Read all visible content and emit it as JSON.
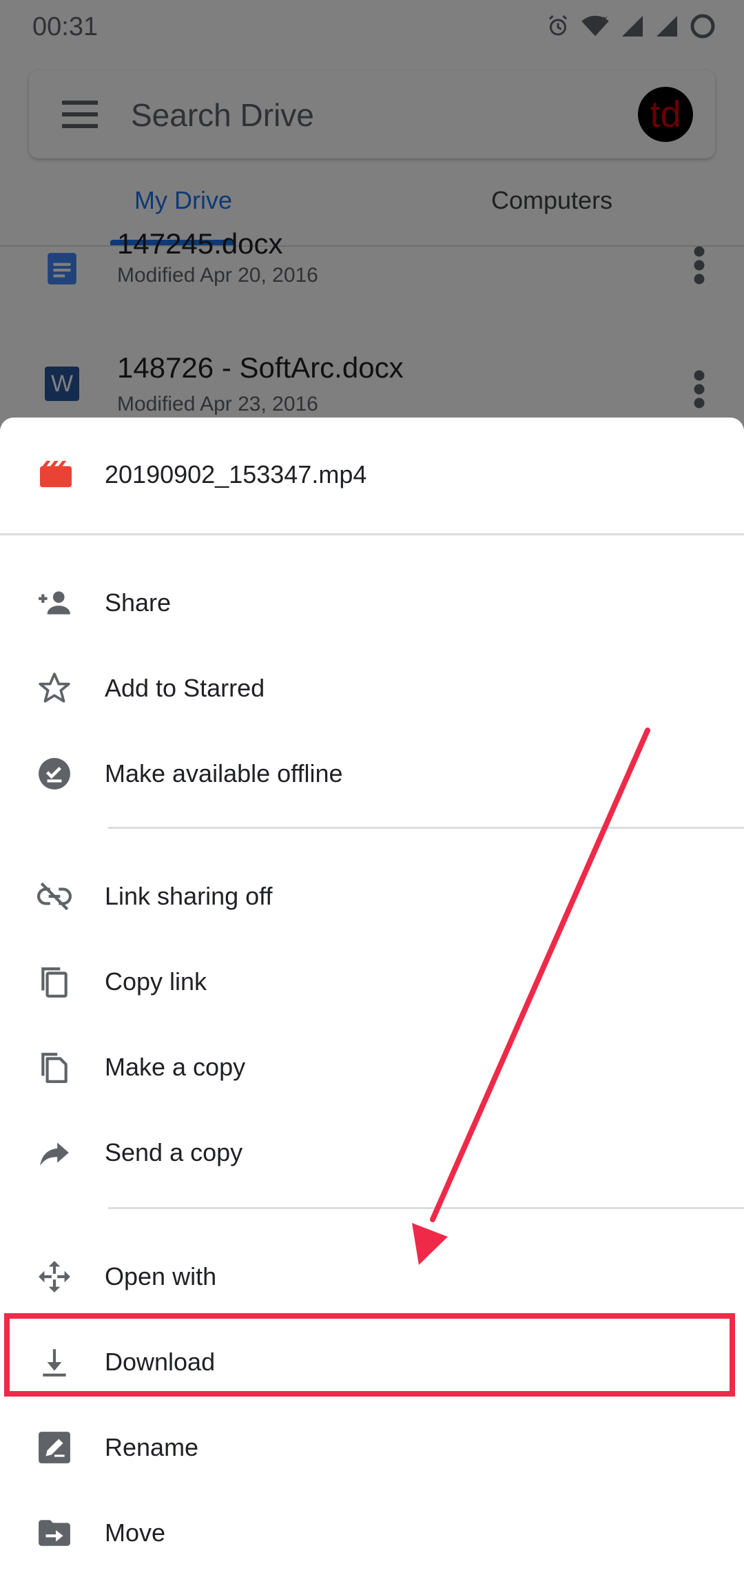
{
  "status_bar": {
    "time": "00:31"
  },
  "search": {
    "placeholder": "Search Drive",
    "value": ""
  },
  "account": {
    "avatar_text": "td"
  },
  "tabs": [
    {
      "label": "My Drive",
      "active": true
    },
    {
      "label": "Computers",
      "active": false
    }
  ],
  "files": [
    {
      "name": "147245.docx",
      "meta": "Modified Apr 20, 2016",
      "icon": "doc-icon"
    },
    {
      "name": "148726 - SoftArc.docx",
      "meta": "Modified Apr 23, 2016",
      "icon": "word-icon",
      "icon_letter": "W"
    }
  ],
  "sheet": {
    "file_name": "20190902_153347.mp4",
    "file_icon": "video-file-icon",
    "groups": [
      [
        {
          "label": "Share",
          "icon": "person-add-icon"
        },
        {
          "label": "Add to Starred",
          "icon": "star-outline-icon"
        },
        {
          "label": "Make available offline",
          "icon": "offline-check-icon"
        }
      ],
      [
        {
          "label": "Link sharing off",
          "icon": "link-off-icon"
        },
        {
          "label": "Copy link",
          "icon": "copy-icon"
        },
        {
          "label": "Make a copy",
          "icon": "file-copy-icon"
        },
        {
          "label": "Send a copy",
          "icon": "share-arrow-icon"
        }
      ],
      [
        {
          "label": "Open with",
          "icon": "open-with-icon"
        },
        {
          "label": "Download",
          "icon": "download-icon"
        },
        {
          "label": "Rename",
          "icon": "rename-icon"
        },
        {
          "label": "Move",
          "icon": "move-folder-icon"
        }
      ]
    ]
  },
  "colors": {
    "accent": "#1a73e8",
    "annotation": "#ee2a48",
    "icon_gray": "#5f6368",
    "video_red": "#ea4335"
  }
}
